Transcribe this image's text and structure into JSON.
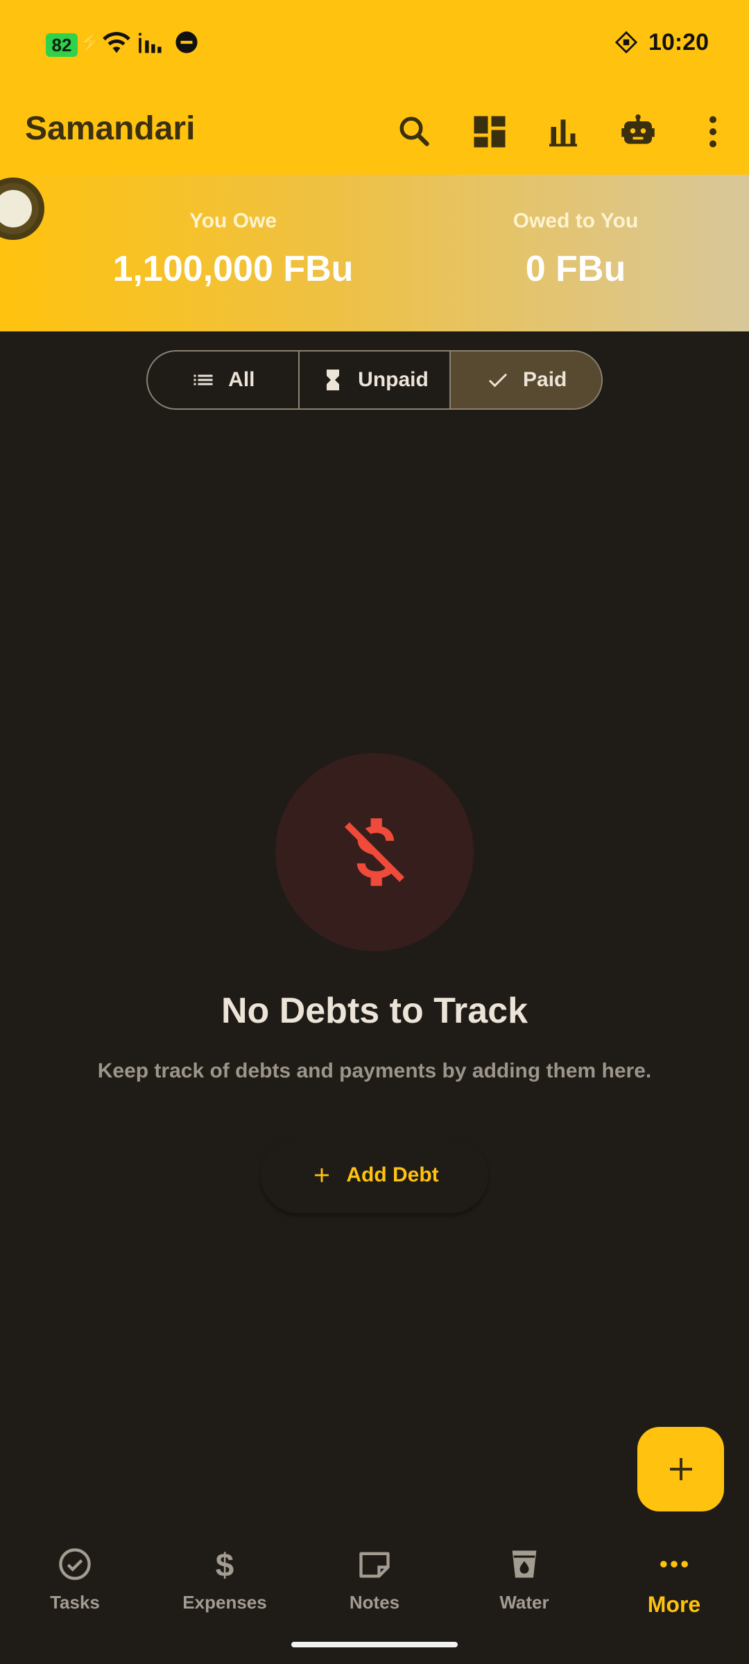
{
  "status_bar": {
    "battery": "82",
    "time": "10:20"
  },
  "app_bar": {
    "title": "Samandari",
    "actions": [
      "search-icon",
      "dashboard-icon",
      "bar-chart-icon",
      "robot-icon",
      "more-vert-icon"
    ]
  },
  "summary": {
    "you_owe_label": "You Owe",
    "you_owe_value": "1,100,000 FBu",
    "owed_to_you_label": "Owed to You",
    "owed_to_you_value": "0 FBu"
  },
  "filter": {
    "options": [
      {
        "label": "All",
        "icon": "list-icon"
      },
      {
        "label": "Unpaid",
        "icon": "hourglass-icon"
      },
      {
        "label": "Paid",
        "icon": "check-icon"
      }
    ],
    "selected": "Paid"
  },
  "empty_state": {
    "title": "No Debts to Track",
    "subtitle": "Keep track of debts and payments by adding them here.",
    "button_label": "Add Debt"
  },
  "bottom_nav": {
    "items": [
      {
        "label": "Tasks",
        "icon": "check-circle-icon"
      },
      {
        "label": "Expenses",
        "icon": "dollar-icon"
      },
      {
        "label": "Notes",
        "icon": "note-icon"
      },
      {
        "label": "Water",
        "icon": "water-glass-icon"
      },
      {
        "label": "More",
        "icon": "more-horiz-icon"
      }
    ],
    "active": "More"
  },
  "colors": {
    "accent": "#ffc20e",
    "background": "#1f1b17",
    "empty_icon": "#f04a3a"
  }
}
